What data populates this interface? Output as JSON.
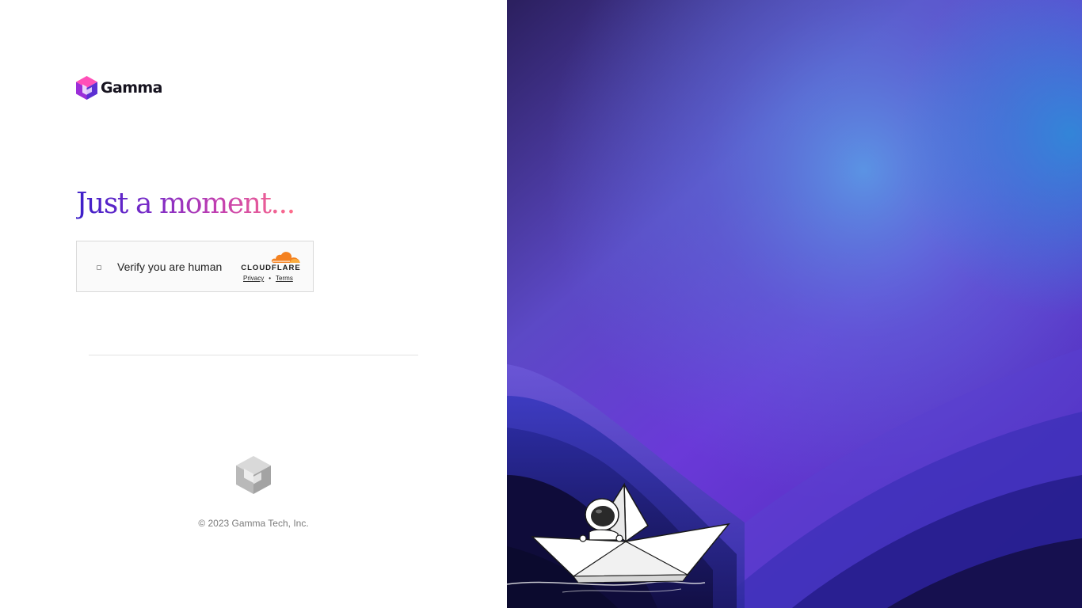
{
  "brand": {
    "name": "Gamma",
    "logo_icon": "gamma-cube-icon",
    "colors": [
      "#ff3fa4",
      "#c030e0",
      "#5a2fd3"
    ]
  },
  "headline": {
    "text": "Just a moment...",
    "gradient": [
      "#3b1fc9",
      "#7b2bc7",
      "#c23fb0",
      "#ff6f8a"
    ]
  },
  "challenge": {
    "label": "Verify you are human",
    "checked": false,
    "provider": "CLOUDFLARE",
    "provider_icon": "cloudflare-cloud-icon",
    "privacy_link": "Privacy",
    "separator": "•",
    "terms_link": "Terms"
  },
  "footer": {
    "logo_icon": "gamma-cube-gray-icon",
    "copyright": "© 2023 Gamma Tech, Inc."
  },
  "hero": {
    "illustration": "astronaut-paper-boat-illustration",
    "colors": [
      "#2a1c5a",
      "#6a3ed6",
      "#4a90e0",
      "#2a1f8f"
    ]
  }
}
